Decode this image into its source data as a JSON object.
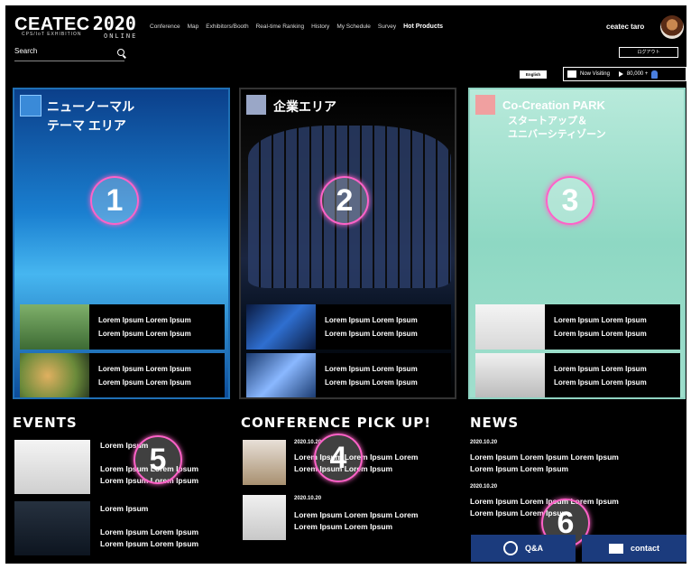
{
  "header": {
    "brand": "CEATEC",
    "year": "2020",
    "brand_sub": "CPS/IoT EXHIBITION",
    "online": "ONLINE",
    "nav": [
      "Conference",
      "Map",
      "Exhibitors/Booth",
      "Real-time Ranking",
      "History",
      "My Schedule",
      "Survey",
      "Hot Products"
    ],
    "search_placeholder": "Search",
    "user_name": "ceatec taro",
    "logout_label": "ログアウト",
    "english_label": "English",
    "visiting_label": "Now Visiting",
    "visiting_count": "80,000 +"
  },
  "cards": [
    {
      "title": "ニューノーマル\nテーマ エリア",
      "number": "1",
      "items": [
        [
          "Lorem Ipsum Lorem Ipsum",
          "Lorem Ipsum Lorem Ipsum"
        ],
        [
          "Lorem Ipsum Lorem Ipsum",
          "Lorem Ipsum Lorem Ipsum"
        ]
      ]
    },
    {
      "title": "企業エリア",
      "number": "2",
      "items": [
        [
          "Lorem Ipsum Lorem Ipsum",
          "Lorem Ipsum Lorem Ipsum"
        ],
        [
          "Lorem Ipsum Lorem Ipsum",
          "Lorem Ipsum Lorem Ipsum"
        ]
      ]
    },
    {
      "title": "Co-Creation PARK",
      "subtitle": "スタートアップ＆\nユニバーシティゾーン",
      "number": "3",
      "items": [
        [
          "Lorem Ipsum Lorem Ipsum",
          "Lorem Ipsum Lorem Ipsum"
        ],
        [
          "Lorem Ipsum Lorem Ipsum",
          "Lorem Ipsum Lorem Ipsum"
        ]
      ]
    }
  ],
  "events": {
    "title": "EVENTS",
    "number": "5",
    "items": [
      {
        "head": "Lorem Ipsum",
        "lines": [
          "Lorem Ipsum Lorem Ipsum",
          "Lorem Ipsum Lorem Ipsum"
        ]
      },
      {
        "head": "Lorem Ipsum",
        "lines": [
          "Lorem Ipsum Lorem Ipsum",
          "Lorem Ipsum Lorem Ipsum"
        ]
      }
    ]
  },
  "conference": {
    "title": "CONFERENCE PICK UP!",
    "number": "4",
    "items": [
      {
        "date": "2020.10.20",
        "lines": [
          "Lorem Ipsum Lorem Ipsum Lorem",
          "Lorem Ipsum Lorem Ipsum"
        ]
      },
      {
        "date": "2020.10.20",
        "lines": [
          "Lorem Ipsum Lorem Ipsum Lorem",
          "Lorem Ipsum Lorem Ipsum"
        ]
      }
    ]
  },
  "news": {
    "title": "NEWS",
    "number": "6",
    "items": [
      {
        "date": "2020.10.20",
        "lines": [
          "Lorem Ipsum Lorem Ipsum Lorem Ipsum",
          "Lorem Ipsum Lorem Ipsum"
        ]
      },
      {
        "date": "2020.10.20",
        "lines": [
          "Lorem Ipsum Lorem Ipsum Lorem Ipsum",
          "Lorem Ipsum Lorem Ipsum"
        ]
      }
    ]
  },
  "buttons": {
    "qa": "Q&A",
    "contact": "contact"
  },
  "colors": {
    "accent_pink": "#ff62c8",
    "button_blue": "#1b3b7d",
    "card1_blue": "#1f6fb5",
    "card3_mint": "#8fd3c2"
  }
}
